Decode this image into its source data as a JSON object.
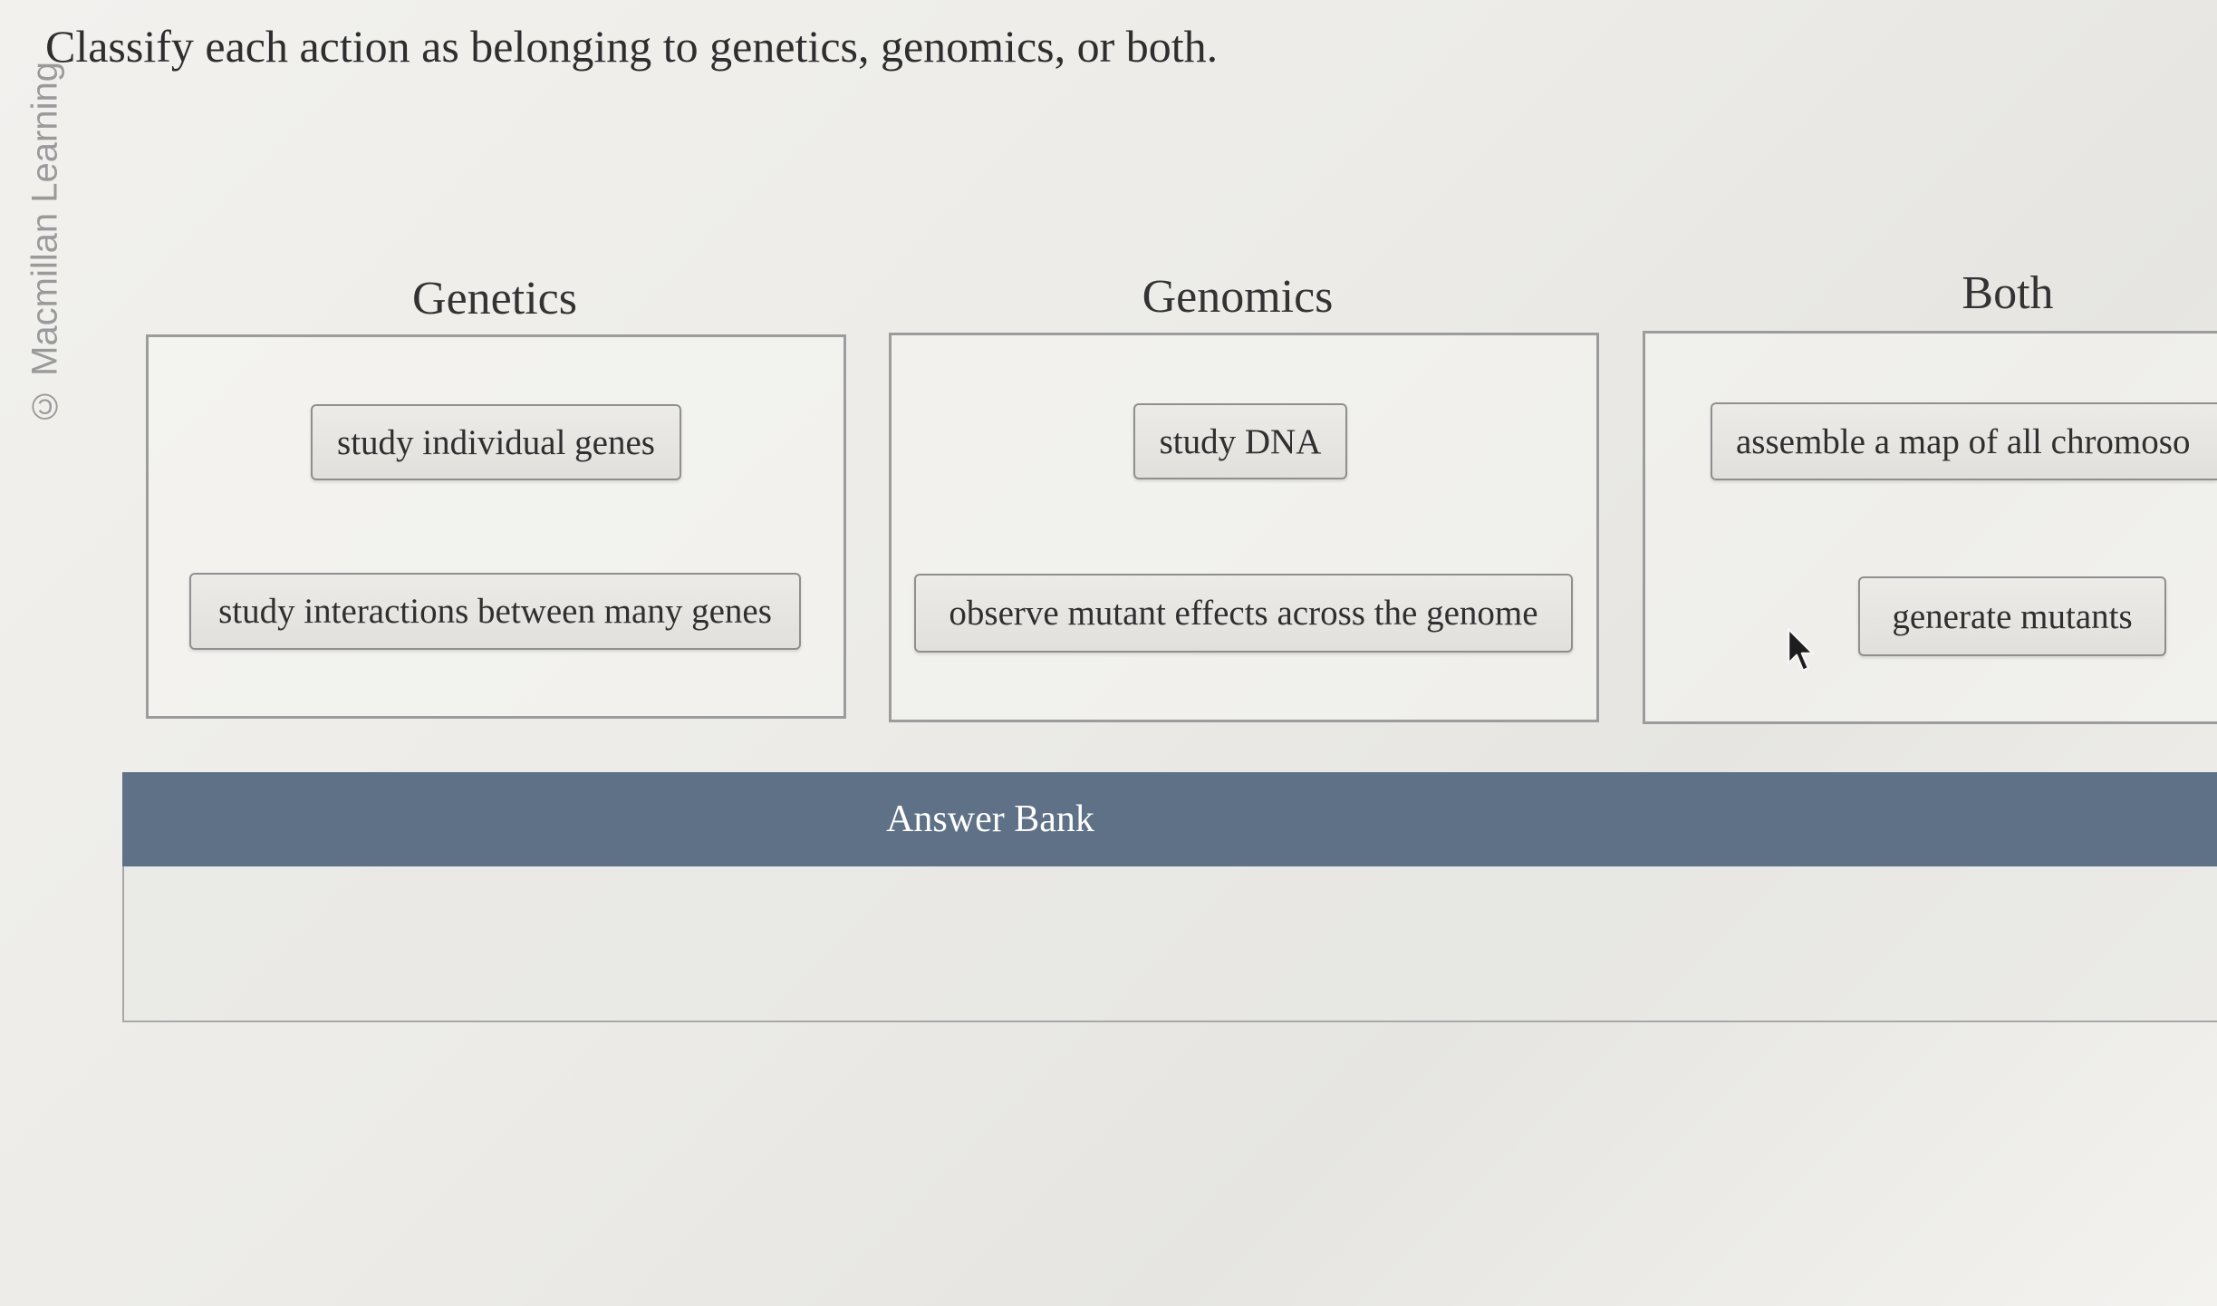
{
  "watermark": "© Macmillan Learning",
  "question": "Classify each action as belonging to genetics, genomics, or both.",
  "columns": [
    {
      "title": "Genetics",
      "items": [
        "study individual genes",
        "study interactions between many genes"
      ]
    },
    {
      "title": "Genomics",
      "items": [
        "study DNA",
        "observe mutant effects across the genome"
      ]
    },
    {
      "title": "Both",
      "items": [
        "assemble a map of all chromoso",
        "generate mutants"
      ]
    }
  ],
  "answer_bank": {
    "title": "Answer Bank",
    "items": []
  },
  "cursor_icon": "arrow-pointer-icon"
}
